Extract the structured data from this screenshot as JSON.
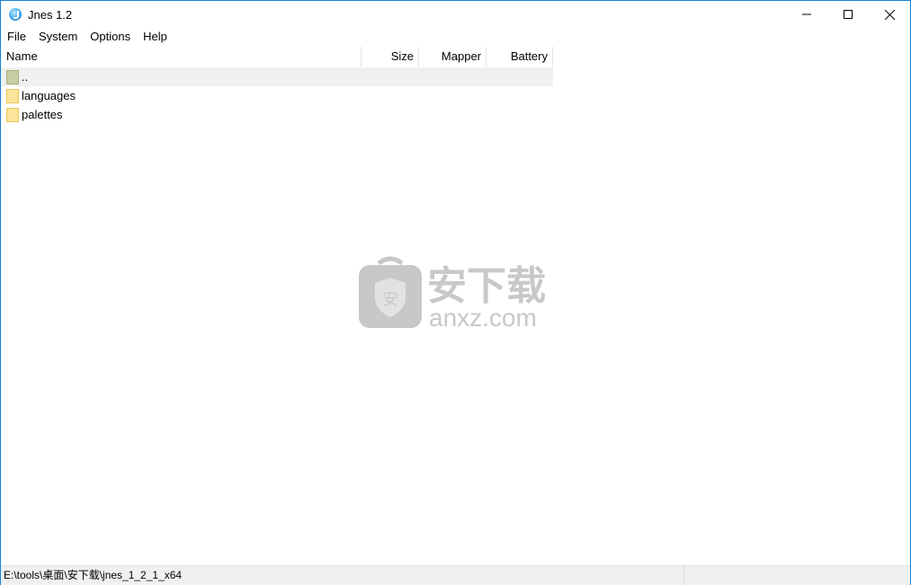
{
  "window": {
    "title": "Jnes 1.2"
  },
  "menu": {
    "items": [
      "File",
      "System",
      "Options",
      "Help"
    ]
  },
  "list": {
    "columns": [
      "Name",
      "Size",
      "Mapper",
      "Battery"
    ],
    "rows": [
      {
        "name": "..",
        "icon": "parent-folder-icon"
      },
      {
        "name": "languages",
        "icon": "folder-icon"
      },
      {
        "name": "palettes",
        "icon": "folder-icon"
      }
    ]
  },
  "watermark": {
    "text_cn": "安下载",
    "text_en": "anxz.com"
  },
  "statusbar": {
    "path": "E:\\tools\\桌面\\安下载\\jnes_1_2_1_x64",
    "right": ""
  },
  "colors": {
    "window_border": "#1883d7",
    "folder": "#fbe59a",
    "selected_row": "#f0f0f0",
    "statusbar_bg": "#f0f0f0"
  }
}
